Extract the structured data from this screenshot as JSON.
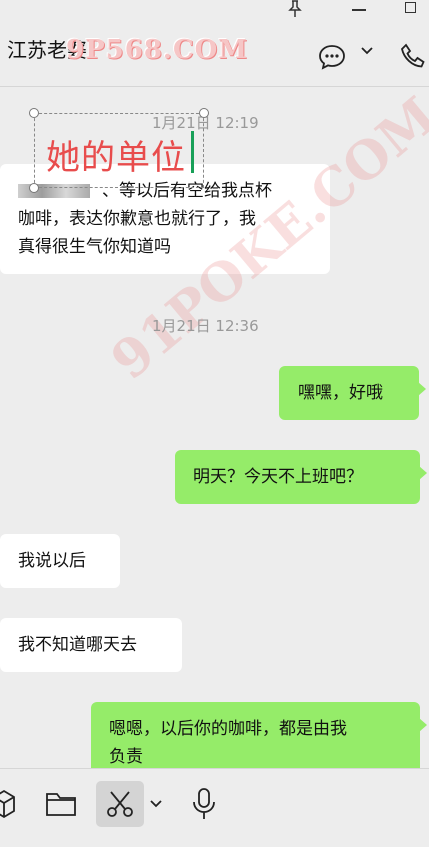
{
  "header": {
    "title": "江苏老婆",
    "watermark": "9P568.COM"
  },
  "annotation": {
    "text": "她的单位",
    "watermark": "91POKE.COM"
  },
  "timestamps": [
    "1月21日 12:19",
    "1月21日 12:36"
  ],
  "messages": [
    {
      "side": "left",
      "line1": "、等以后有空给我点杯",
      "line2": "咖啡，表达你歉意也就行了，我",
      "line3": "真得很生气你知道吗"
    },
    {
      "side": "right",
      "text": "嘿嘿，好哦"
    },
    {
      "side": "right",
      "text": "明天？今天不上班吧？"
    },
    {
      "side": "left",
      "text": "我说以后"
    },
    {
      "side": "left",
      "text": "我不知道哪天去"
    },
    {
      "side": "right",
      "line1": "嗯嗯，以后你的咖啡，都是由我",
      "line2": "负责"
    }
  ],
  "icons": [
    "pin-icon",
    "minimize-icon",
    "maximize-icon",
    "chat-bubble-icon",
    "chevron-down-icon",
    "phone-icon",
    "cube-icon",
    "folder-icon",
    "scissors-icon",
    "microphone-icon"
  ]
}
